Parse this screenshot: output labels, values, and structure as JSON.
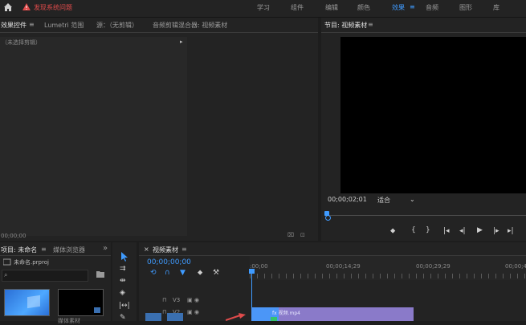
{
  "topbar": {
    "warning_text": "发现系统问题",
    "workspaces": [
      "学习",
      "组件",
      "编辑",
      "颜色",
      "效果",
      "音频",
      "图形",
      "库"
    ],
    "active_workspace": "效果",
    "active_menu_glyph": "≡"
  },
  "source_panel": {
    "tabs": [
      "效果控件",
      "Lumetri 范围",
      "源：（无剪辑）",
      "音频剪辑混合器: 视频素材"
    ],
    "menu_glyph": "≡",
    "no_clip_text": "（未选择剪辑）",
    "timecode": "00;00;00"
  },
  "program_panel": {
    "title": "节目: 视频素材",
    "menu_glyph": "≡",
    "timecode": "00;00;02;01",
    "fit_label": "适合",
    "transport": [
      "⬥",
      "{",
      "}",
      "|◂",
      "◂|",
      "▶",
      "|▸",
      "▸|"
    ]
  },
  "project_panel": {
    "title": "项目: 未命名",
    "menu_glyph": "≡",
    "media_browser_tab": "媒体浏览器",
    "more_glyph": "»",
    "filename": "未命名.prproj",
    "thumbnails": [
      "",
      "媒体素材"
    ]
  },
  "timeline": {
    "title": "视频素材",
    "menu_glyph": "≡",
    "close_glyph": "×",
    "timecode": "00;00;00;00",
    "ruler_labels": [
      ":00;00",
      "00;00;14;29",
      "00;00;29;29",
      "00;00;44;"
    ],
    "tracks": [
      {
        "lock": "🔒",
        "name": "V3",
        "icons": "▣ ◉"
      },
      {
        "lock": "🔒",
        "name": "V2",
        "icons": "▣ ◉"
      }
    ],
    "clip_label": "fx 视频.mp4"
  },
  "colors": {
    "accent": "#3f9bff",
    "warning": "#e04b4b",
    "clip": "#8a7ac9"
  }
}
